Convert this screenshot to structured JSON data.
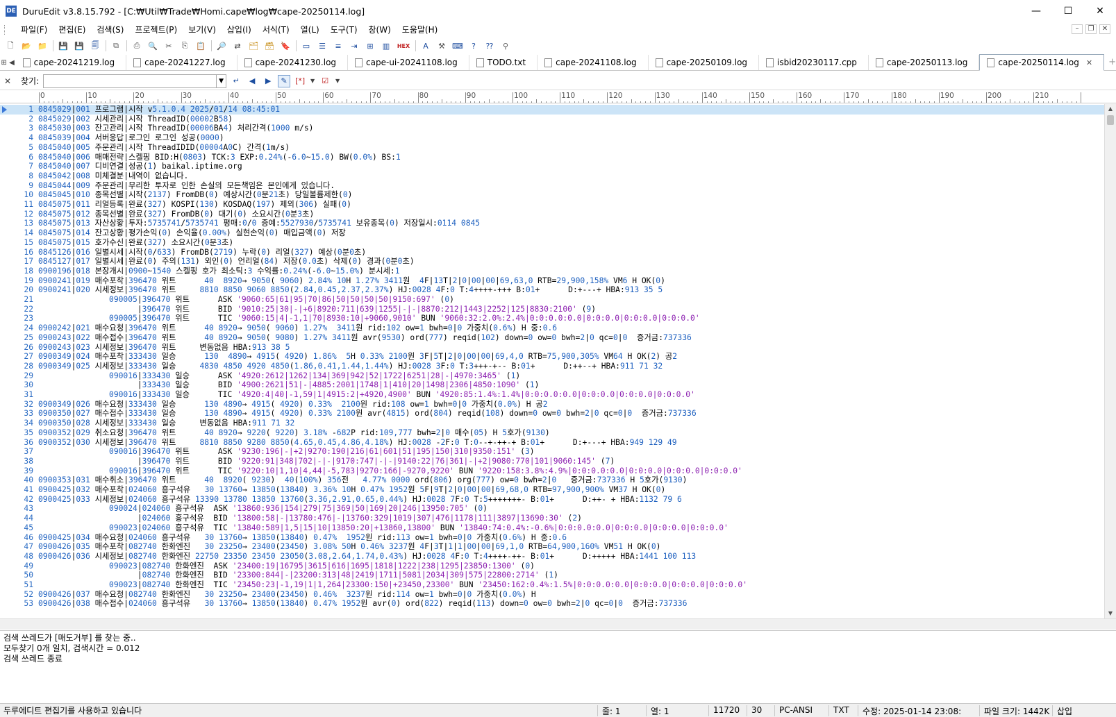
{
  "window": {
    "app_icon": "DE",
    "title": "DuruEdit v3.8.15.792 - [C:₩Util₩Trade₩Homi.cape₩log₩cape-20250114.log]",
    "minimize": "—",
    "maximize": "☐",
    "close": "✕"
  },
  "menu": [
    "파일(F)",
    "편집(E)",
    "검색(S)",
    "프로젝트(P)",
    "보기(V)",
    "삽입(I)",
    "서식(T)",
    "열(L)",
    "도구(T)",
    "창(W)",
    "도움말(H)"
  ],
  "mdi": {
    "minimize": "–",
    "restore": "❐",
    "close": "✕"
  },
  "toolbar_icons": [
    {
      "name": "new-file-icon",
      "glyph": "🗋",
      "color": "#333333"
    },
    {
      "name": "open-file-icon",
      "glyph": "📂",
      "color": "#c8901c"
    },
    {
      "name": "open-folder-icon",
      "glyph": "📁",
      "color": "#c8901c"
    },
    {
      "name": "sep",
      "glyph": ""
    },
    {
      "name": "save-icon",
      "glyph": "💾",
      "color": "#b02020"
    },
    {
      "name": "save-as-icon",
      "glyph": "💾",
      "color": "#204fa0"
    },
    {
      "name": "save-all-icon",
      "glyph": "🗐",
      "color": "#204fa0"
    },
    {
      "name": "sep",
      "glyph": ""
    },
    {
      "name": "copy-path-icon",
      "glyph": "⧉",
      "color": "#555555"
    },
    {
      "name": "sep",
      "glyph": ""
    },
    {
      "name": "print-icon",
      "glyph": "⎙",
      "color": "#555555"
    },
    {
      "name": "print-preview-icon",
      "glyph": "🔍",
      "color": "#555555"
    },
    {
      "name": "cut-icon",
      "glyph": "✂",
      "color": "#555555"
    },
    {
      "name": "copy-icon",
      "glyph": "⎘",
      "color": "#555555"
    },
    {
      "name": "paste-icon",
      "glyph": "📋",
      "color": "#a07020"
    },
    {
      "name": "sep",
      "glyph": ""
    },
    {
      "name": "find-icon",
      "glyph": "🔎",
      "color": "#333333"
    },
    {
      "name": "replace-icon",
      "glyph": "⇄",
      "color": "#333333"
    },
    {
      "name": "find-in-files-icon",
      "glyph": "🗂",
      "color": "#c8901c"
    },
    {
      "name": "replace-in-files-icon",
      "glyph": "🗃",
      "color": "#c8901c"
    },
    {
      "name": "bookmark-icon",
      "glyph": "🔖",
      "color": "#c8901c"
    },
    {
      "name": "sep",
      "glyph": ""
    },
    {
      "name": "window-icon",
      "glyph": "▭",
      "color": "#204fa0"
    },
    {
      "name": "list-icon",
      "glyph": "☰",
      "color": "#204fa0"
    },
    {
      "name": "list-alt-icon",
      "glyph": "≡",
      "color": "#204fa0"
    },
    {
      "name": "indent-icon",
      "glyph": "⇥",
      "color": "#204fa0"
    },
    {
      "name": "outline-icon",
      "glyph": "⊞",
      "color": "#204fa0"
    },
    {
      "name": "columns-icon",
      "glyph": "▥",
      "color": "#204fa0"
    },
    {
      "name": "hex-icon",
      "glyph": "HEX",
      "color": "#c02020"
    },
    {
      "name": "sep",
      "glyph": ""
    },
    {
      "name": "font-icon",
      "glyph": "A",
      "color": "#204fa0"
    },
    {
      "name": "tools-icon",
      "glyph": "⚒",
      "color": "#555555"
    },
    {
      "name": "keyboard-icon",
      "glyph": "⌨",
      "color": "#204fa0"
    },
    {
      "name": "help-icon",
      "glyph": "?",
      "color": "#204fa0"
    },
    {
      "name": "context-help-icon",
      "glyph": "⁇",
      "color": "#204fa0"
    },
    {
      "name": "pin-icon",
      "glyph": "⚲",
      "color": "#555555"
    }
  ],
  "tabs": [
    {
      "label": "cape-20241219.log",
      "active": false
    },
    {
      "label": "cape-20241227.log",
      "active": false
    },
    {
      "label": "cape-20241230.log",
      "active": false
    },
    {
      "label": "cape-ui-20241108.log",
      "active": false
    },
    {
      "label": "TODO.txt",
      "active": false
    },
    {
      "label": "cape-20241108.log",
      "active": false
    },
    {
      "label": "cape-20250109.log",
      "active": false
    },
    {
      "label": "isbid20230117.cpp",
      "active": false
    },
    {
      "label": "cape-20250113.log",
      "active": false
    },
    {
      "label": "cape-20250114.log",
      "active": true
    }
  ],
  "tab_nav_icons": {
    "list": "⊞",
    "prev": "◀"
  },
  "tab_close": "✕",
  "tab_add": "+",
  "findbar": {
    "close": "✕",
    "label": "찾기:",
    "value": "",
    "placeholder": ""
  },
  "ruler": {
    "labels": [
      "0",
      "10",
      "20",
      "30",
      "40",
      "50",
      "60",
      "70",
      "80",
      "90",
      "100",
      "110",
      "120",
      "130",
      "140",
      "150",
      "160",
      "170",
      "180",
      "190",
      "200",
      "210"
    ]
  },
  "editor_lines": [
    {
      "n": "1",
      "t": "0845029|001 프로그램|시작 v5.1.0.4 2025/01/14 08:45:01"
    },
    {
      "n": "2",
      "t": "0845029|002 시세관리|시작 ThreadID(00002B58)"
    },
    {
      "n": "3",
      "t": "0845030|003 잔고관리|시작 ThreadID(00006BA4) 처리간격(1000 m/s)"
    },
    {
      "n": "4",
      "t": "0845039|004 서버응답|로그인 로그인 성공(0000)"
    },
    {
      "n": "5",
      "t": "0845040|005 주문관리|시작 ThreadIDID(00004A0C) 간격(1m/s)"
    },
    {
      "n": "6",
      "t": "0845040|006 매매전략|스켈핑 BID:H(0803) TCK:3 EXP:0.24%(-6.0~15.0) BW(0.0%) BS:1"
    },
    {
      "n": "7",
      "t": "0845040|007 디비연결|성공(1) baikal.iptime.org"
    },
    {
      "n": "8",
      "t": "0845042|008 미체결분|내역이 없습니다."
    },
    {
      "n": "9",
      "t": "0845044|009 주문관리|무리한 투자로 인한 손실의 모든책임은 본인에게 있습니다."
    },
    {
      "n": "10",
      "t": "0845045|010 종목선별|시작(2137) FromDB(0) 예상시간(0분21초) 당일볼륨제한(0)"
    },
    {
      "n": "11",
      "t": "0845075|011 리얼등록|완료(327) KOSPI(130) KOSDAQ(197) 제외(306) 실패(0)"
    },
    {
      "n": "12",
      "t": "0845075|012 종목선별|완료(327) FromDB(0) 대기(0) 소요시간(0분3초)"
    },
    {
      "n": "13",
      "t": "0845075|013 자산상황|투자:5735741/5735741 평매:0/0 증예:5527930/5735741 보유종목(0) 저장일시:0114 0845"
    },
    {
      "n": "14",
      "t": "0845075|014 잔고상황|평가손익(0) 손익율(0.00%) 실현손익(0) 매입금액(0) 저장"
    },
    {
      "n": "15",
      "t": "0845075|015 호가수신|완료(327) 소요시간(0분3초)"
    },
    {
      "n": "16",
      "t": "0845126|016 일별시세|시작(0/633) FromDB(2719) 누락(0) 리얼(327) 예상(0분0초)"
    },
    {
      "n": "17",
      "t": "0845127|017 일별시세|완료(0) 주의(131) 외인(0) 언리얼(84) 저장(0.0초) 삭제(0) 경과(0분0초)"
    },
    {
      "n": "18",
      "t": "0900196|018 본장개시|0900~1540 스켈핑 호가 최소틱:3 수익률:0.24%(-6.0~15.0%) 분시세:1"
    },
    {
      "n": "19",
      "t": "0900241|019 매수포착|396470 위트      40  8920→ 9050( 9060) 2.84% 10H 1.27% 3411원  4F|13T|2|0|00|00|69,63,0 RTB=29,900,158% VM6 H OK(0)"
    },
    {
      "n": "20",
      "t": "0900241|020 시세정보|396470 위트     8810 8850 9060 8850(2.84,0.45,2.37,2.37%) HJ:0028 4F:0 T:4++++-+++ B:01+      D:+---+ HBA:913 35 5"
    },
    {
      "n": "21",
      "t": "               090005|396470 위트      ASK '9060:65|61|95|70|86|50|50|50|50|9150:697' (0)"
    },
    {
      "n": "22",
      "t": "                     |396470 위트      BID '9010:25|30|-|+6|8920:711|639|1255|-|-|8870:212|1443|2252|125|8830:2100' (9)"
    },
    {
      "n": "23",
      "t": "               090005|396470 위트      TIC '9060:15|4|-1,1|70|8930:10|+9060,9010' BUN '9060:32:2.0%:2.4%|0:0:0.0:0.0|0:0:0.0|0:0:0.0|0:0:0.0'"
    },
    {
      "n": "24",
      "t": "0900242|021 매수요청|396470 위트      40 8920→ 9050( 9060) 1.27%  3411원 rid:102 ow=1 bwh=0|0 가중치(0.6%) H 중:0.6"
    },
    {
      "n": "25",
      "t": "0900243|022 매수접수|396470 위트      40 8920→ 9050( 9080) 1.27% 3411원 avr(9530) ord(777) reqid(102) down=0 ow=0 bwh=2|0 qc=0|0  증거금:737336"
    },
    {
      "n": "26",
      "t": "0900243|023 시세정보|396470 위트     변동없음 HBA:913 38 5"
    },
    {
      "n": "27",
      "t": "0900349|024 매수포착|333430 일승      130  4890→ 4915( 4920) 1.86%  5H 0.33% 2100원 3F|5T|2|0|00|00|69,4,0 RTB=75,900,305% VM64 H OK(2) 공2"
    },
    {
      "n": "28",
      "t": "0900349|025 시세정보|333430 일승     4830 4850 4920 4850(1.86,0.41,1.44,1.44%) HJ:0028 3F:0 T:3+++-+-- B:01+      D:++--+ HBA:911 71 32"
    },
    {
      "n": "29",
      "t": "               090016|333430 일승      ASK '4920:2612|1262|134|369|942|52|1722|6251|28|-|4970:3465' (1)"
    },
    {
      "n": "30",
      "t": "                     |333430 일승      BID '4900:2621|51|-|4885:2001|1748|1|410|20|1498|2306|4850:1090' (1)"
    },
    {
      "n": "31",
      "t": "               090016|333430 일승      TIC '4920:4|40|-1,59|1|4915:2|+4920,4900' BUN '4920:85:1.4%:1.4%|0:0:0.0:0.0|0:0:0.0|0:0:0.0|0:0:0.0'"
    },
    {
      "n": "32",
      "t": "0900349|026 매수요청|333430 일승      130 4890→ 4915( 4920) 0.33%  2100원 rid:108 ow=1 bwh=0|0 가중치(0.0%) H 공2"
    },
    {
      "n": "33",
      "t": "0900350|027 매수접수|333430 일승      130 4890→ 4915( 4920) 0.33% 2100원 avr(4815) ord(804) reqid(108) down=0 ow=0 bwh=2|0 qc=0|0  증거금:737336"
    },
    {
      "n": "34",
      "t": "0900350|028 시세정보|333430 일승     변동없음 HBA:911 71 32"
    },
    {
      "n": "35",
      "t": "0900352|029 취소요청|396470 위트      40 8920→ 9220( 9220) 3.18% -682P rid:109,777 bwh=2|0 매수(05) H 5호가(9130)"
    },
    {
      "n": "36",
      "t": "0900352|030 시세정보|396470 위트     8810 8850 9280 8850(4.65,0.45,4.86,4.18%) HJ:0028 -2F:0 T:0--+-++-+ B:01+      D:+---+ HBA:949 129 49"
    },
    {
      "n": "37",
      "t": "               090016|396470 위트      ASK '9230:196|-|+2|9270:190|216|61|601|51|195|150|310|9350:151' (3)"
    },
    {
      "n": "38",
      "t": "                     |396470 위트      BID '9220:91|348|702|-|-|9170:747|-|-|9140:22|76|361|-|+2|9080:770|101|9060:145' (7)"
    },
    {
      "n": "39",
      "t": "               090016|396470 위트      TIC '9220:10|1,10|4,44|-5,783|9270:166|-9270,9220' BUN '9220:158:3.8%:4.9%|0:0:0.0:0.0|0:0:0.0|0:0:0.0|0:0:0.0'"
    },
    {
      "n": "40",
      "t": "0900353|031 매수취소|396470 위트      40  8920( 9230)  40(100%) 356전   4.77% 0000 ord(806) org(777) ow=0 bwh=2|0   증거금:737336 H 5호가(9130)"
    },
    {
      "n": "41",
      "t": "0900425|032 매수포착|024060 흥구석유   30 13760→ 13850(13840) 3.36% 10H 0.47% 1952원 5F|9T|2|0|00|00|69,68,0 RTB=97,900,900% VM37 H OK(0)"
    },
    {
      "n": "42",
      "t": "0900425|033 시세정보|024060 흥구석유 13390 13780 13850 13760(3.36,2.91,0.65,0.44%) HJ:0028 7F:0 T:5+++++++- B:01+      D:++- + HBA:1132 79 6"
    },
    {
      "n": "43",
      "t": "               090024|024060 흥구석유  ASK '13860:936|154|279|75|369|50|169|20|246|13950:705' (0)"
    },
    {
      "n": "44",
      "t": "                     |024060 흥구석유  BID '13800:58|-|13780:476|-|13760:329|1019|307|476|1178|111|3897|13690:30' (2)"
    },
    {
      "n": "45",
      "t": "               090023|024060 흥구석유  TIC '13840:589|1,5|15|10|13850:20|+13860,13800' BUN '13840:74:0.4%:-0.6%|0:0:0.0:0.0|0:0:0.0|0:0:0.0|0:0:0.0'"
    },
    {
      "n": "46",
      "t": "0900425|034 매수요청|024060 흥구석유   30 13760→ 13850(13840) 0.47%  1952원 rid:113 ow=1 bwh=0|0 가중치(0.6%) H 중:0.6"
    },
    {
      "n": "47",
      "t": "0900426|035 매수포착|082740 한화엔진   30 23250→ 23400(23450) 3.08% 50H 0.46% 3237원 4F|3T|1|1|00|00|69,1,0 RTB=64,900,160% VM51 H OK(0)"
    },
    {
      "n": "48",
      "t": "0900426|036 시세정보|082740 한화엔진 22750 23350 23450 23050(3.08,2.64,1.74,0.43%) HJ:0028 4F:0 T:4++++-++- B:01+      D:+++++ HBA:1441 100 113"
    },
    {
      "n": "49",
      "t": "               090023|082740 한화엔진  ASK '23400:19|16795|3615|616|1695|1818|1222|238|1295|23850:1300' (0)"
    },
    {
      "n": "50",
      "t": "                     |082740 한화엔진  BID '23300:844|-|23200:313|48|2419|1711|5081|2034|309|575|22800:2714' (1)"
    },
    {
      "n": "51",
      "t": "               090023|082740 한화엔진  TIC '23450:23|-1,19|1|1,264|23300:150|+23450,23300' BUN '23450:162:0.4%:1.5%|0:0:0.0:0.0|0:0:0.0|0:0:0.0|0:0:0.0'"
    },
    {
      "n": "52",
      "t": "0900426|037 매수요청|082740 한화엔진   30 23250→ 23400(23450) 0.46%  3237원 rid:114 ow=1 bwh=0|0 가중치(0.0%) H"
    },
    {
      "n": "53",
      "t": "0900426|038 매수접수|024060 흥구석유   30 13760→ 13850(13840) 0.47% 1952원 avr(0) ord(822) reqid(113) down=0 ow=0 bwh=2|0 qc=0|0  증거금:737336"
    }
  ],
  "scroll": {
    "up": "▲",
    "down": "▼"
  },
  "output_lines": [
    "검색 쓰레드가 [매도거부] 를 찾는 중..",
    "모두찾기 0개 일치, 검색시간 = 0.012",
    "검색 쓰레드 종료"
  ],
  "status": {
    "message": "두루에디트 편집기를 사용하고 있습니다",
    "line": "줄: 1",
    "col": "열: 1",
    "size_chars": "11720",
    "tab": "30",
    "encoding": "PC-ANSI",
    "type": "TXT",
    "modified": "수정: 2025-01-14 23:08:",
    "file_size": "파일 크기: 1442K",
    "mode": "삽입"
  },
  "colors": {
    "line_number": "#2b6cc4",
    "current_line_bg": "#cce4f7",
    "string": "#8b1fb0",
    "number": "#1c5fbf"
  }
}
